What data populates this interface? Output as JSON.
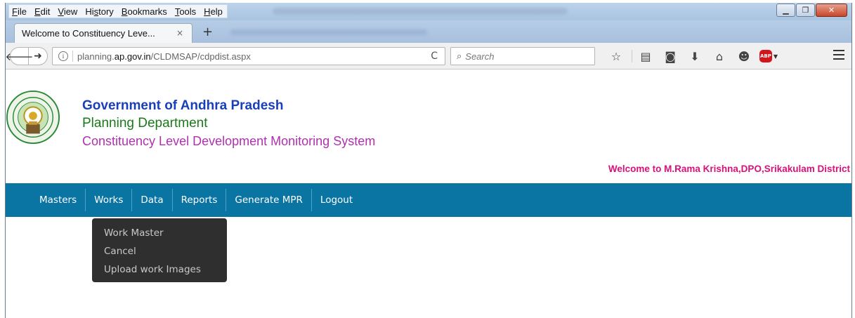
{
  "window": {
    "menu": [
      "File",
      "Edit",
      "View",
      "History",
      "Bookmarks",
      "Tools",
      "Help"
    ],
    "menu_mnemonics": [
      "F",
      "E",
      "V",
      "s",
      "B",
      "T",
      "H"
    ]
  },
  "tab": {
    "title": "Welcome to Constituency Leve...",
    "close": "×",
    "new_tab": "+"
  },
  "nav": {
    "url_host": "planning.ap.gov.in",
    "url_prefix": "planning.",
    "url_domain": "ap.gov.in",
    "url_path": "/CLDMSAP/cdpdist.aspx",
    "search_placeholder": "Search"
  },
  "icons": [
    "back-icon",
    "forward-icon",
    "info-icon",
    "reload-icon",
    "search-icon",
    "bookmark-star-icon",
    "reading-list-icon",
    "pocket-icon",
    "download-icon",
    "home-icon",
    "chat-icon",
    "adblock-icon",
    "menu-icon"
  ],
  "header": {
    "title": "Government of Andhra Pradesh",
    "department": "Planning Department",
    "system": "Constituency Level Development Monitoring System",
    "welcome": "Welcome to M.Rama Krishna,DPO,Srikakulam District"
  },
  "main_nav": {
    "items": [
      "Masters",
      "Works",
      "Data",
      "Reports",
      "Generate MPR",
      "Logout"
    ],
    "active": "Works"
  },
  "works_menu": {
    "items": [
      "Work Master",
      "Cancel",
      "Upload work Images"
    ]
  },
  "colors": {
    "nav_bg": "#0a74a3",
    "title_blue": "#1a40b8",
    "dept_green": "#1a7a1a",
    "system_magenta": "#b030b0",
    "welcome_pink": "#d6117a",
    "dropdown_bg": "#2f2f2f"
  }
}
